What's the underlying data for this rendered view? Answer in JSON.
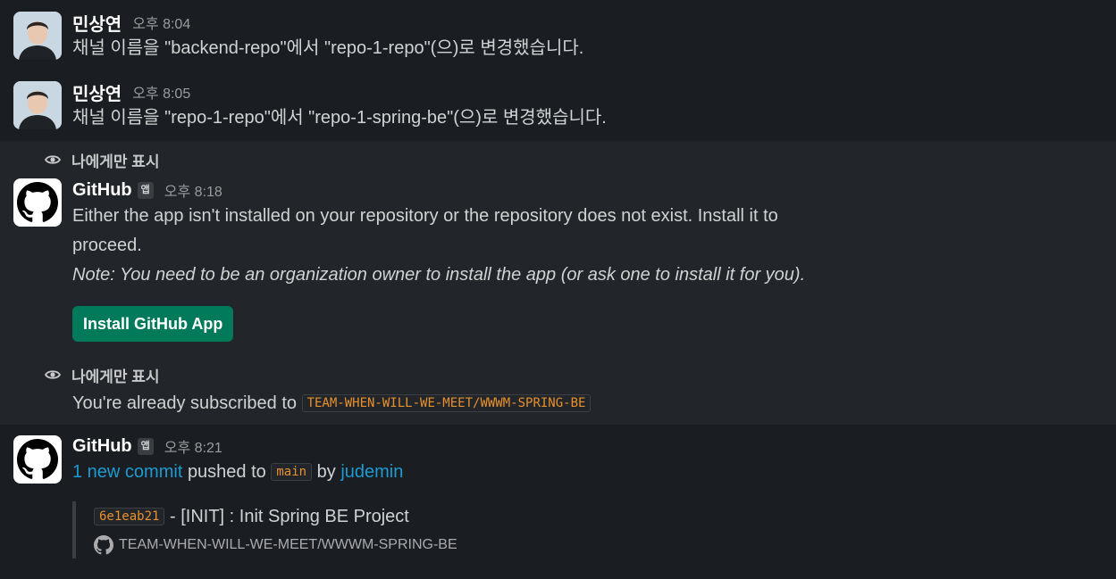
{
  "messages": [
    {
      "author": "민상연",
      "time": "오후 8:04",
      "text": "채널 이름을 \"backend-repo\"에서 \"repo-1-repo\"(으)로 변경했습니다."
    },
    {
      "author": "민상연",
      "time": "오후 8:05",
      "text": "채널 이름을 \"repo-1-repo\"에서 \"repo-1-spring-be\"(으)로 변경했습니다."
    }
  ],
  "ephemeral_label": "나에게만 표시",
  "github_install": {
    "author": "GitHub",
    "badge": "앱",
    "time": "오후 8:18",
    "line1": "Either the app isn't installed on your repository or the repository does not exist. Install it to",
    "line2": "proceed.",
    "note": "Note: You need to be an organization owner to install the app (or ask one to install it for you).",
    "button": "Install GitHub App"
  },
  "subscribed": {
    "label": "나에게만 표시",
    "text": "You're already subscribed to",
    "repo": "TEAM-WHEN-WILL-WE-MEET/WWWM-SPRING-BE"
  },
  "github_commit": {
    "author": "GitHub",
    "badge": "앱",
    "time": "오후 8:21",
    "commit_link": "1 new commit",
    "pushed_to": "pushed to",
    "branch": "main",
    "by": "by",
    "user": "judemin",
    "sha": "6e1eab21",
    "message": "- [INIT] : Init Spring BE Project",
    "repo": "TEAM-WHEN-WILL-WE-MEET/WWWM-SPRING-BE"
  },
  "colors": {
    "background": "#1a1d21",
    "ephemeral_bg": "#222529",
    "link": "#1d9bd1",
    "code": "#e8912d",
    "button": "#007a5a"
  }
}
